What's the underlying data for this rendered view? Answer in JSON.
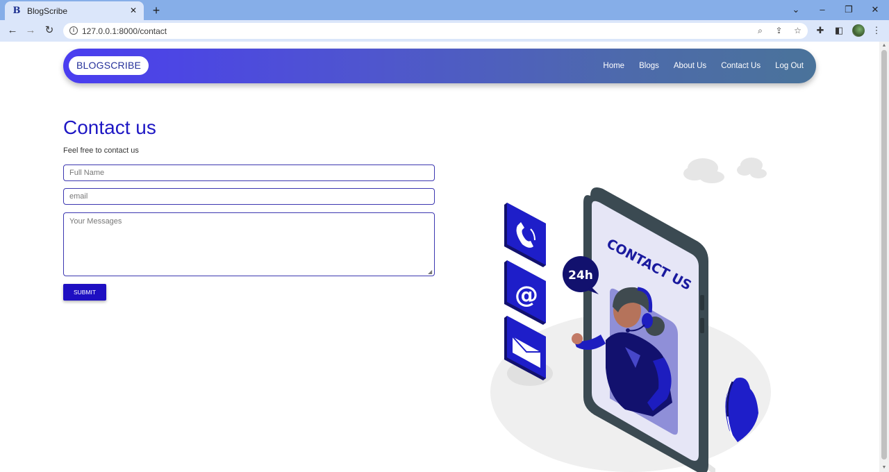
{
  "browser": {
    "tab_title": "BlogScribe",
    "tab_favicon": "B",
    "url": "127.0.0.1:8000/contact"
  },
  "navbar": {
    "brand": "BLOGSCRIBE",
    "links": [
      "Home",
      "Blogs",
      "About Us",
      "Contact Us",
      "Log Out"
    ]
  },
  "contact": {
    "title": "Contact us",
    "subtitle": "Feel free to contact us",
    "name_placeholder": "Full Name",
    "email_placeholder": "email",
    "message_placeholder": "Your Messages",
    "submit_label": "SUBMIT"
  },
  "illustration": {
    "banner_text": "CONTACT US",
    "badge_text": "24h"
  },
  "colors": {
    "accent": "#1e17c4",
    "submit": "#1e0fc2",
    "navbar_start": "#4a3df0",
    "navbar_end": "#4a739a"
  },
  "icons": [
    "back-arrow-icon",
    "forward-arrow-icon",
    "reload-icon",
    "info-icon",
    "zoom-icon",
    "share-icon",
    "star-icon",
    "extensions-icon",
    "sidebar-icon",
    "menu-icon",
    "phone-icon",
    "at-sign-icon",
    "envelope-icon"
  ]
}
